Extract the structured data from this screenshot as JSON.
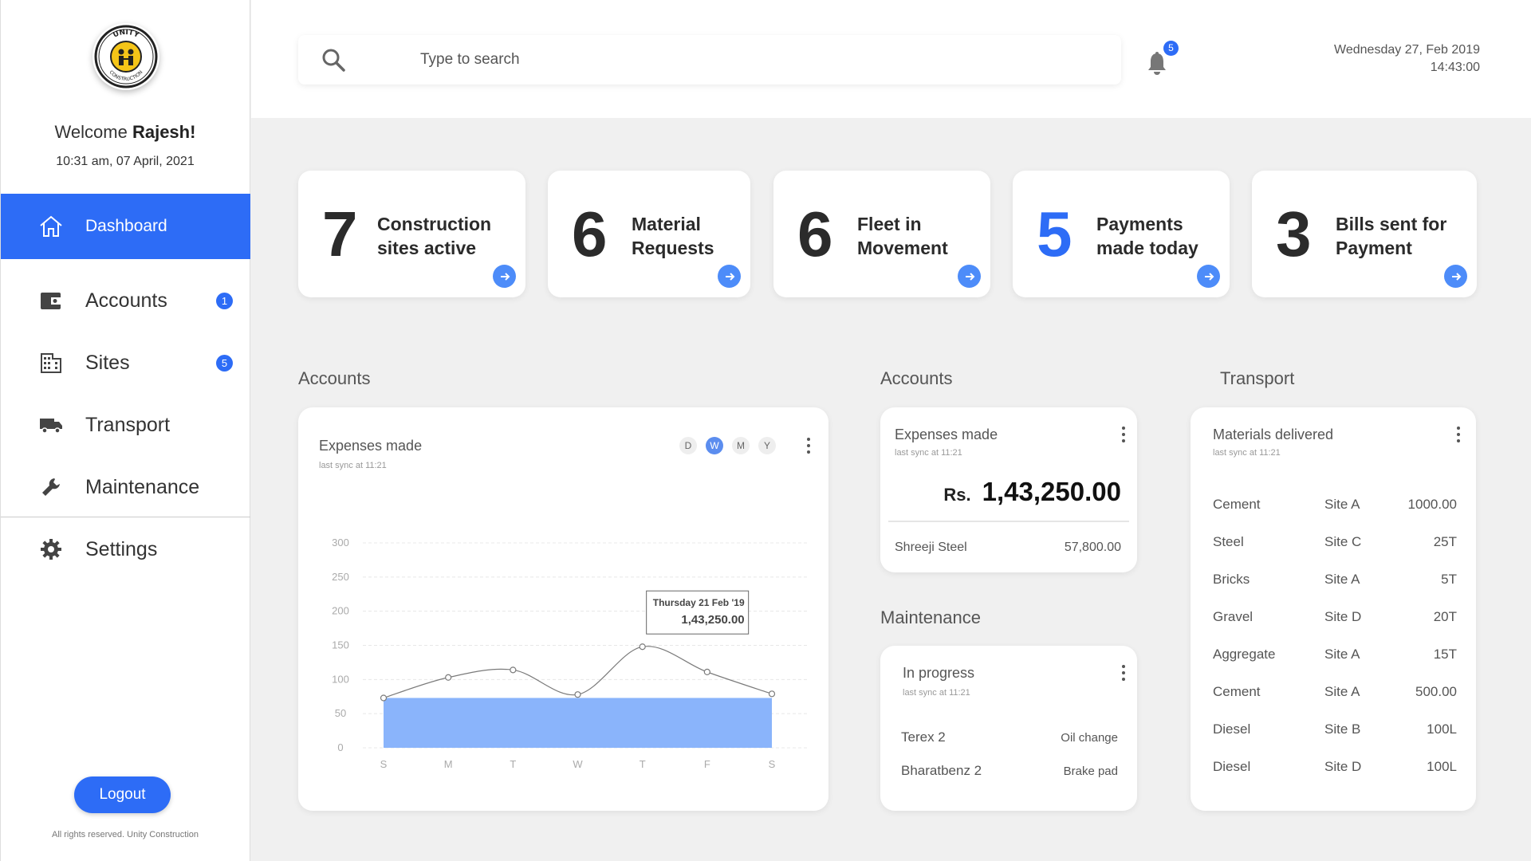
{
  "sidebar": {
    "logo_text": "UNITY CONSTRUCTION",
    "welcome_prefix": "Welcome ",
    "user_name": "Rajesh!",
    "datetime": "10:31 am, 07 April, 2021",
    "items": [
      {
        "label": "Dashboard",
        "icon": "home-icon",
        "active": true
      },
      {
        "label": "Accounts",
        "icon": "wallet-icon",
        "badge": "1"
      },
      {
        "label": "Sites",
        "icon": "building-icon",
        "badge": "5"
      },
      {
        "label": "Transport",
        "icon": "truck-icon"
      },
      {
        "label": "Maintenance",
        "icon": "wrench-icon"
      },
      {
        "label": "Settings",
        "icon": "gear-icon"
      }
    ],
    "logout_label": "Logout",
    "rights": "All rights reserved. Unity Construction"
  },
  "header": {
    "search_placeholder": "Type to search",
    "notification_count": "5",
    "date": "Wednesday 27, Feb 2019",
    "time": "14:43:00"
  },
  "stats": [
    {
      "value": "7",
      "line1": "Construction",
      "line2": "sites active"
    },
    {
      "value": "6",
      "line1": "Material",
      "line2": "Requests"
    },
    {
      "value": "6",
      "line1": "Fleet in",
      "line2": "Movement"
    },
    {
      "value": "5",
      "line1": "Payments",
      "line2": "made today",
      "accent": "#2d6cf6"
    },
    {
      "value": "3",
      "line1": "Bills sent for",
      "line2": "Payment"
    }
  ],
  "accounts_chart": {
    "section_title": "Accounts",
    "card_title": "Expenses made",
    "sync": "last sync at 11:21",
    "ranges": [
      "D",
      "W",
      "M",
      "Y"
    ],
    "active_range": "W",
    "tooltip_date": "Thursday  21 Feb '19",
    "tooltip_value": "1,43,250.00"
  },
  "chart_data": {
    "type": "line",
    "categories": [
      "S",
      "M",
      "T",
      "W",
      "T",
      "F",
      "S"
    ],
    "series": [
      {
        "values": [
          73,
          103,
          114,
          78,
          148,
          111,
          79
        ]
      }
    ],
    "baseline_fill": 73,
    "yticks": [
      "0",
      "50",
      "100",
      "150",
      "200",
      "250",
      "300"
    ],
    "ylim": [
      0,
      300
    ],
    "colors": {
      "line": "#7a7a7a",
      "fill": "#8ab4fb"
    }
  },
  "accounts_summary": {
    "section_title": "Accounts",
    "card_title": "Expenses made",
    "sync": "last sync at 11:21",
    "currency": "Rs.",
    "amount": "1,43,250.00",
    "vendor": "Shreeji Steel",
    "vendor_amount": "57,800.00"
  },
  "maintenance": {
    "section_title": "Maintenance",
    "card_title": "In progress",
    "sync": "last sync at 11:21",
    "rows": [
      {
        "vehicle": "Terex 2",
        "task": "Oil change"
      },
      {
        "vehicle": "Bharatbenz 2",
        "task": "Brake pad"
      }
    ]
  },
  "transport": {
    "section_title": "Transport",
    "card_title": "Materials delivered",
    "sync": "last sync at 11:21",
    "rows": [
      {
        "material": "Cement",
        "site": "Site A",
        "qty": "1000.00"
      },
      {
        "material": "Steel",
        "site": "Site C",
        "qty": "25T"
      },
      {
        "material": "Bricks",
        "site": "Site A",
        "qty": "5T"
      },
      {
        "material": "Gravel",
        "site": "Site D",
        "qty": "20T"
      },
      {
        "material": "Aggregate",
        "site": "Site A",
        "qty": "15T"
      },
      {
        "material": "Cement",
        "site": "Site A",
        "qty": "500.00"
      },
      {
        "material": "Diesel",
        "site": "Site B",
        "qty": "100L"
      },
      {
        "material": "Diesel",
        "site": "Site D",
        "qty": "100L"
      }
    ]
  },
  "colors": {
    "accent": "#2d6cf6",
    "background": "#f0f0f0"
  }
}
